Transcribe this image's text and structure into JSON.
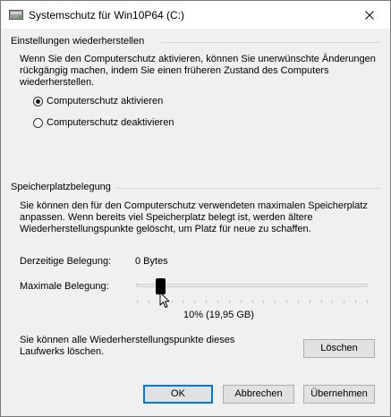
{
  "window": {
    "title": "Systemschutz für Win10P64 (C:)"
  },
  "restore_settings": {
    "group_title": "Einstellungen wiederherstellen",
    "description": "Wenn Sie den Computerschutz aktivieren, können Sie unerwünschte Änderungen rückgängig machen, indem Sie einen früheren Zustand des Computers wiederherstellen.",
    "options": [
      {
        "label": "Computerschutz aktivieren",
        "checked": true
      },
      {
        "label": "Computerschutz deaktivieren",
        "checked": false
      }
    ]
  },
  "disk_space": {
    "group_title": "Speicherplatzbelegung",
    "description": "Sie können den für den Computerschutz verwendeten maximalen Speicherplatz anpassen. Wenn bereits viel Speicherplatz belegt ist, werden ältere Wiederherstellungspunkte gelöscht, um Platz für neue zu schaffen.",
    "current_usage_label": "Derzeitige Belegung:",
    "current_usage_value": "0 Bytes",
    "max_usage_label": "Maximale Belegung:",
    "max_usage_percent": 10,
    "max_usage_display": "10% (19,95 GB)",
    "delete_text": "Sie können alle Wiederherstellungspunkte dieses Laufwerks löschen.",
    "delete_button": "Löschen"
  },
  "footer": {
    "ok": "OK",
    "cancel": "Abbrechen",
    "apply": "Übernehmen"
  },
  "icons": {
    "title": "drive-icon",
    "close": "close-icon",
    "cursor": "mouse-pointer-icon"
  }
}
